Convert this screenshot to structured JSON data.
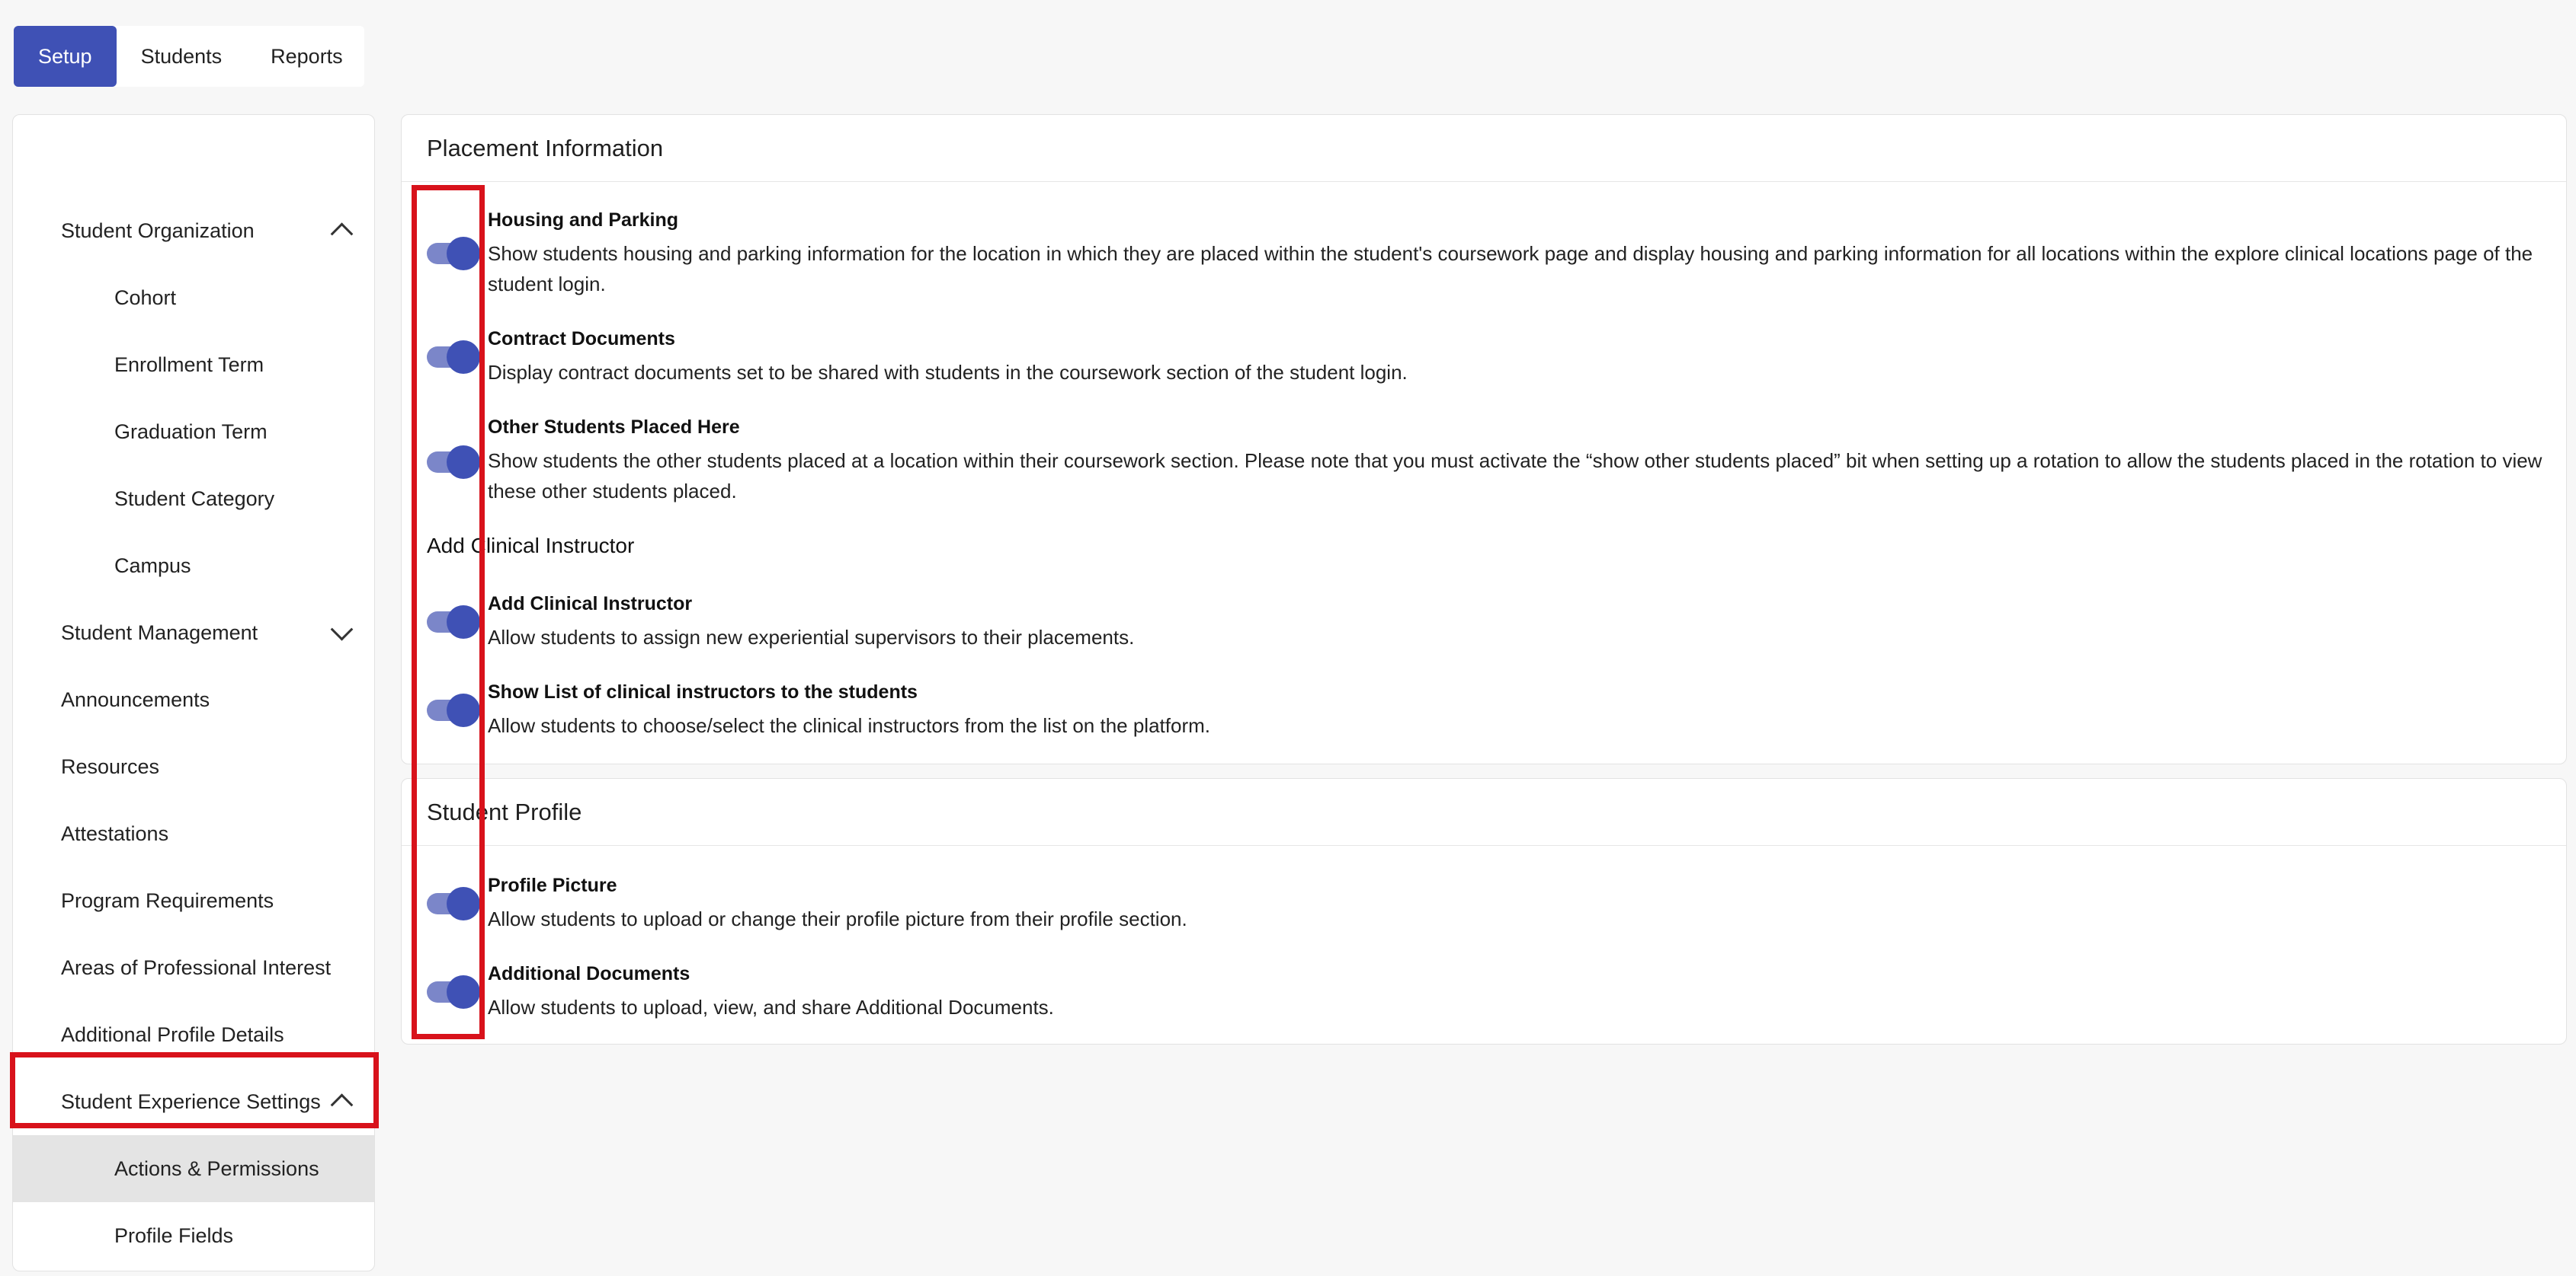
{
  "top_tabs": [
    {
      "label": "Setup",
      "active": true
    },
    {
      "label": "Students",
      "active": false
    },
    {
      "label": "Reports",
      "active": false
    }
  ],
  "sidebar": {
    "items": [
      {
        "label": "Student Organization",
        "chevron": "up"
      },
      {
        "label": "Cohort"
      },
      {
        "label": "Enrollment Term"
      },
      {
        "label": "Graduation Term"
      },
      {
        "label": "Student Category"
      },
      {
        "label": "Campus"
      },
      {
        "label": "Student Management",
        "chevron": "down"
      },
      {
        "label": "Announcements"
      },
      {
        "label": "Resources"
      },
      {
        "label": "Attestations"
      },
      {
        "label": "Program Requirements"
      },
      {
        "label": "Areas of Professional Interest"
      },
      {
        "label": "Additional Profile Details"
      },
      {
        "label": "Student Experience Settings",
        "chevron": "up"
      },
      {
        "label": "Actions & Permissions",
        "active": true
      },
      {
        "label": "Profile Fields"
      }
    ]
  },
  "placement": {
    "title": "Placement Information",
    "settings": [
      {
        "title": "Housing and Parking",
        "desc": "Show students housing and parking information for the location in which they are placed within the student's coursework page and display housing and parking information for all locations within the explore clinical locations page of the student login.",
        "enabled": true
      },
      {
        "title": "Contract Documents",
        "desc": "Display contract documents set to be shared with students in the coursework section of the student login.",
        "enabled": true
      },
      {
        "title": "Other Students Placed Here",
        "desc": "Show students the other students placed at a location within their coursework section. Please note that you must activate the “show other students placed” bit when setting up a rotation to allow the students placed in the rotation to view these other students placed.",
        "enabled": true
      }
    ],
    "subheading": "Add Clinical Instructor",
    "sub_settings": [
      {
        "title": "Add Clinical Instructor",
        "desc": "Allow students to assign new experiential supervisors to their placements.",
        "enabled": true
      },
      {
        "title": "Show List of clinical instructors to the students",
        "desc": "Allow students to choose/select the clinical instructors from the list on the platform.",
        "enabled": true
      }
    ]
  },
  "profile": {
    "title": "Student Profile",
    "settings": [
      {
        "title": "Profile Picture",
        "desc": "Allow students to upload or change their profile picture from their profile section.",
        "enabled": true
      },
      {
        "title": "Additional Documents",
        "desc": "Allow students to upload, view, and share Additional Documents.",
        "enabled": true
      }
    ]
  },
  "colors": {
    "accent": "#3f51b5",
    "highlight": "#d8121b"
  }
}
